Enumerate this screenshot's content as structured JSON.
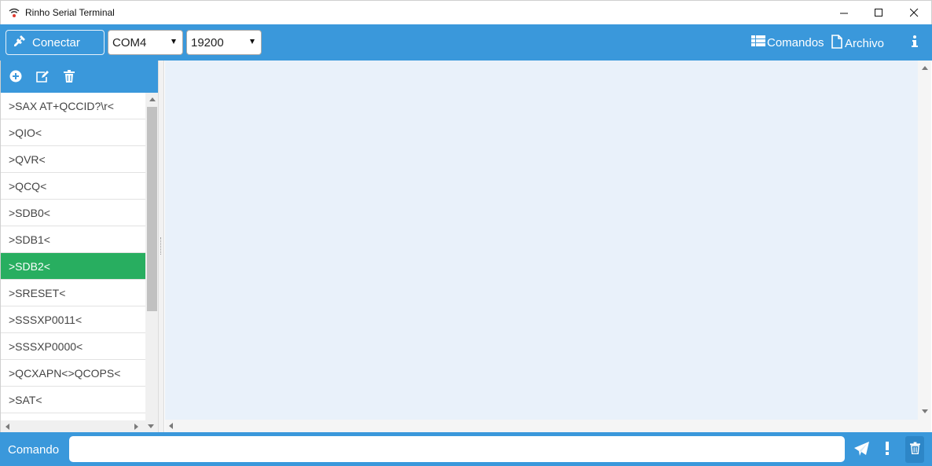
{
  "window": {
    "title": "Rinho Serial Terminal"
  },
  "toolbar": {
    "connect_label": "Conectar",
    "port_value": "COM4",
    "baud_value": "19200",
    "comandos_label": "Comandos",
    "archivo_label": "Archivo"
  },
  "commands": {
    "items": [
      {
        "label": ">SAX AT+QCCID?\\r<"
      },
      {
        "label": ">QIO<"
      },
      {
        "label": ">QVR<"
      },
      {
        "label": ">QCQ<"
      },
      {
        "label": ">SDB0<"
      },
      {
        "label": ">SDB1<"
      },
      {
        "label": ">SDB2<"
      },
      {
        "label": ">SRESET<"
      },
      {
        "label": ">SSSXP0011<"
      },
      {
        "label": ">SSSXP0000<"
      },
      {
        "label": ">QCXAPN<>QCOPS<"
      },
      {
        "label": ">SAT<"
      }
    ],
    "selected_index": 6
  },
  "bottom": {
    "command_label": "Comando",
    "command_value": "",
    "command_placeholder": ""
  },
  "colors": {
    "accent": "#3a98db",
    "selected": "#28ae60",
    "terminal_bg": "#e9f1fa"
  },
  "icons": {
    "app": "wifi-signal-icon",
    "connect": "plug-icon",
    "comandos": "table-icon",
    "archivo": "file-icon",
    "info": "info-icon",
    "add": "plus-circle-icon",
    "edit": "edit-icon",
    "delete": "trash-icon",
    "send": "paper-plane-icon",
    "alert": "exclamation-icon",
    "clear": "trash-icon"
  }
}
